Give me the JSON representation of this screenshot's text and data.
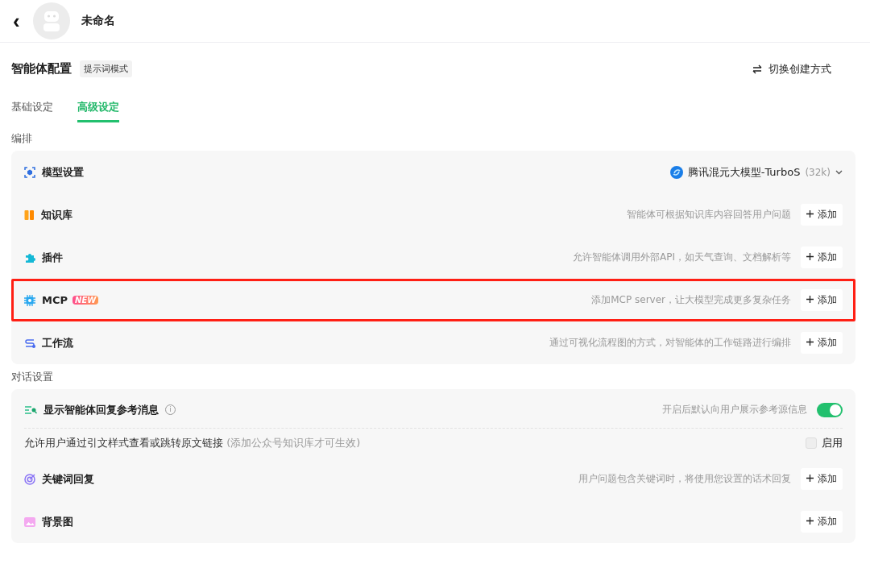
{
  "header": {
    "back": "‹",
    "title": "未命名"
  },
  "config": {
    "title": "智能体配置",
    "mode_tag": "提示词模式",
    "switch_label": "切换创建方式"
  },
  "tabs": [
    {
      "label": "基础设定",
      "selected": false
    },
    {
      "label": "高级设定",
      "selected": true
    }
  ],
  "sections": [
    {
      "title": "编排",
      "rows": [
        {
          "kind": "model",
          "label": "模型设置",
          "model": "腾讯混元大模型-TurboS",
          "context": "(32k)"
        },
        {
          "kind": "add",
          "label": "知识库",
          "description": "智能体可根据知识库内容回答用户问题",
          "button": "添加",
          "highlighted": false
        },
        {
          "kind": "add",
          "label": "插件",
          "description": "允许智能体调用外部API，如天气查询、文档解析等",
          "button": "添加",
          "highlighted": false
        },
        {
          "kind": "add",
          "label": "MCP",
          "badge": "NEW",
          "description": "添加MCP server，让大模型完成更多复杂任务",
          "button": "添加",
          "highlighted": true
        },
        {
          "kind": "add",
          "label": "工作流",
          "description": "通过可视化流程图的方式，对智能体的工作链路进行编排",
          "button": "添加",
          "highlighted": false
        }
      ]
    },
    {
      "title": "对话设置",
      "rows": [
        {
          "kind": "toggle",
          "label": "显示智能体回复参考消息",
          "info": "i",
          "description": "开启后默认向用户展示参考源信息",
          "on": true
        },
        {
          "kind": "checkbox",
          "label": "允许用户通过引文样式查看或跳转原文链接",
          "note": "(添加公众号知识库才可生效)",
          "option": "启用",
          "checked": false
        },
        {
          "kind": "add",
          "label": "关键词回复",
          "description": "用户问题包含关键词时，将使用您设置的话术回复",
          "button": "添加",
          "highlighted": false
        },
        {
          "kind": "add",
          "label": "背景图",
          "button": "添加",
          "highlighted": false
        }
      ]
    }
  ]
}
